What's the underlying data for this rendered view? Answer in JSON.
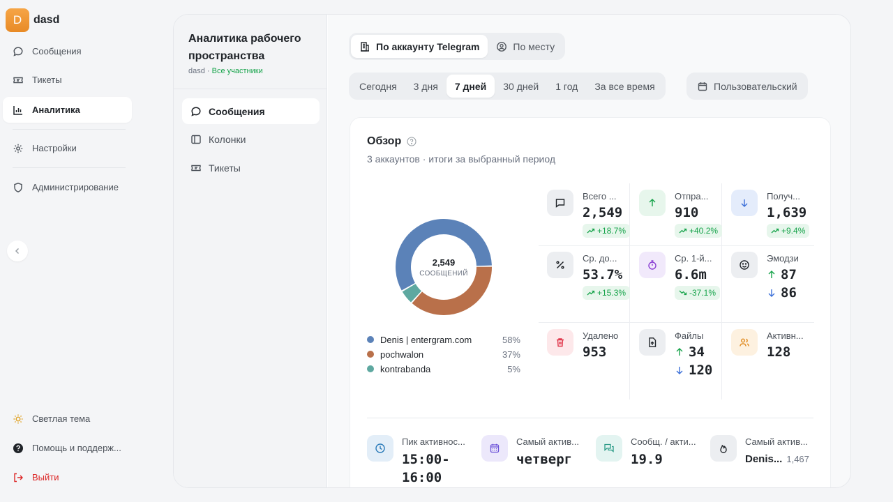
{
  "brand": {
    "initial": "D",
    "name": "dasd"
  },
  "nav": {
    "messages": "Сообщения",
    "tickets": "Тикеты",
    "analytics": "Аналитика",
    "settings": "Настройки",
    "admin": "Администрирование",
    "theme": "Светлая тема",
    "help": "Помощь и поддерж...",
    "logout": "Выйти"
  },
  "workspace": {
    "title": "Аналитика рабочего пространства",
    "sub_name": "dasd",
    "sub_sep": " · ",
    "sub_members": "Все участники"
  },
  "subnav": {
    "messages": "Сообщения",
    "columns": "Колонки",
    "tickets": "Тикеты"
  },
  "scope_tabs": {
    "telegram": "По аккаунту Telegram",
    "place": "По месту"
  },
  "periods": {
    "today": "Сегодня",
    "d3": "3 дня",
    "d7": "7 дней",
    "d30": "30 дней",
    "y1": "1 год",
    "all": "За все время",
    "custom": "Пользовательский"
  },
  "overview": {
    "title": "Обзор",
    "subtitle": "3 аккаунтов · итоги за выбранный период",
    "total": "2,549",
    "total_label": "СООБЩЕНИЙ"
  },
  "chart_data": {
    "type": "pie",
    "categories": [
      "Denis | entergram.com",
      "pochwalon",
      "kontrabanda"
    ],
    "values": [
      58,
      37,
      5
    ],
    "labels": [
      "58%",
      "37%",
      "5%"
    ],
    "colors": [
      "#5b82b8",
      "#b9704a",
      "#5ea8a0"
    ]
  },
  "stats": {
    "total": {
      "label": "Всего ...",
      "value": "2,549",
      "delta": "+18.7%"
    },
    "sent": {
      "label": "Отпра...",
      "value": "910",
      "delta": "+40.2%"
    },
    "received": {
      "label": "Получ...",
      "value": "1,639",
      "delta": "+9.4%"
    },
    "avg_share": {
      "label": "Ср. до...",
      "value": "53.7%",
      "delta": "+15.3%"
    },
    "first_reply": {
      "label": "Ср. 1-й...",
      "value": "6.6m",
      "delta": "-37.1%"
    },
    "emoji": {
      "label": "Эмодзи",
      "up": "87",
      "down": "86"
    },
    "deleted": {
      "label": "Удалено",
      "value": "953"
    },
    "files": {
      "label": "Файлы",
      "up": "34",
      "down": "120"
    },
    "active": {
      "label": "Активн...",
      "value": "128"
    }
  },
  "bottom": {
    "peak": {
      "label": "Пик активнос...",
      "value": "15:00-16:00"
    },
    "day": {
      "label": "Самый актив...",
      "value": "четверг"
    },
    "per_active": {
      "label": "Сообщ. / акти...",
      "value": "19.9"
    },
    "top_user": {
      "label": "Самый актив...",
      "value": "Denis...",
      "count": "1,467"
    }
  },
  "colors": {
    "accent_green": "#16a34a",
    "danger": "#dc2626",
    "brand_orange": "#f09a3a"
  }
}
